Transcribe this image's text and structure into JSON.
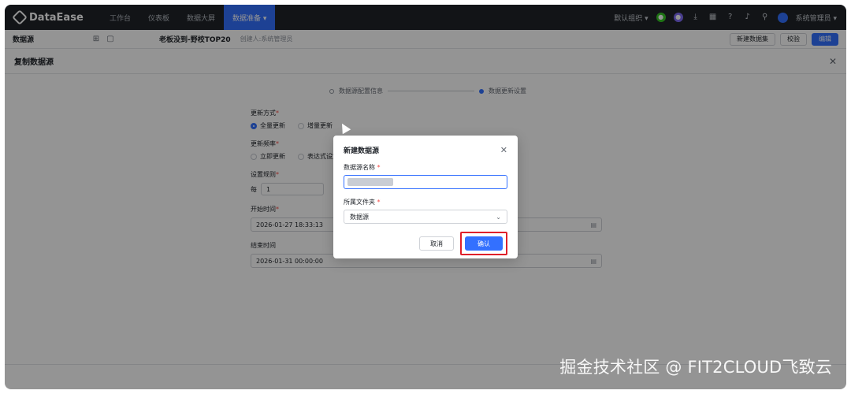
{
  "topnav": {
    "brand": "DataEase",
    "items": [
      {
        "label": "工作台"
      },
      {
        "label": "仪表板"
      },
      {
        "label": "数据大屏"
      },
      {
        "label": "数据准备 ▾"
      }
    ],
    "org": "默认组织 ▾",
    "user": "系统管理员 ▾"
  },
  "subbar": {
    "title": "数据源",
    "datasource_name": "老板没到-野校TOP20",
    "hint": "创建人:系统管理员",
    "new_dataset": "新建数据集",
    "check": "校验",
    "edit": "编辑"
  },
  "drawer": {
    "title": "复制数据源",
    "steps": [
      "数据源配置信息",
      "数据更新设置"
    ],
    "update_mode_label": "更新方式",
    "update_mode_options": [
      "全量更新",
      "增量更新"
    ],
    "freq_label": "更新频率",
    "freq_options": [
      "立即更新",
      "表达式设定"
    ],
    "rule_label": "设置规则",
    "rule_prefix": "每",
    "rule_value": "1",
    "start_label": "开始时间",
    "start_value": "2026-01-27 18:33:13",
    "end_label": "结束时间",
    "end_value": "2026-01-31 00:00:00"
  },
  "modal": {
    "title": "新建数据源",
    "name_label": "数据源名称",
    "folder_label": "所属文件夹",
    "folder_value": "数据源",
    "cancel": "取消",
    "confirm": "确认"
  },
  "watermark": "掘金技术社区 @ FIT2CLOUD飞致云"
}
